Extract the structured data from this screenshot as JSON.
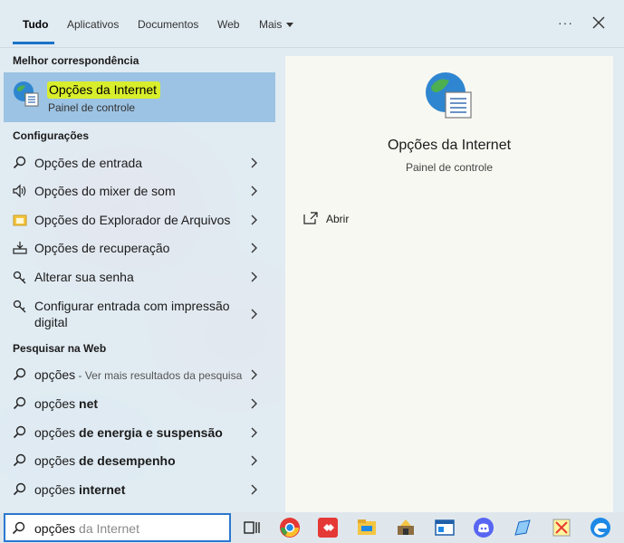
{
  "tabs": [
    "Tudo",
    "Aplicativos",
    "Documentos",
    "Web",
    "Mais"
  ],
  "toolbar": {
    "more_options": "···"
  },
  "sections": {
    "best_match": "Melhor correspondência",
    "settings": "Configurações",
    "web": "Pesquisar na Web"
  },
  "best_match": {
    "title": "Opções da Internet",
    "subtitle": "Painel de controle",
    "highlight_color": "#d8ee2c"
  },
  "settings_items": [
    {
      "label": "Opções de entrada",
      "icon": "search-icon"
    },
    {
      "label": "Opções do mixer de som",
      "icon": "speaker-icon"
    },
    {
      "label": "Opções do Explorador de Arquivos",
      "icon": "folder-icon"
    },
    {
      "label": "Opções de recuperação",
      "icon": "recovery-icon"
    },
    {
      "label": "Alterar sua senha",
      "icon": "key-icon"
    },
    {
      "label": "Configurar entrada com impressão digital",
      "icon": "key-icon"
    }
  ],
  "web_items": [
    {
      "prefix": "opções",
      "suffix": "",
      "hint": " - Ver mais resultados da pesquisa"
    },
    {
      "prefix": "opções ",
      "suffix": "net",
      "hint": ""
    },
    {
      "prefix": "opções ",
      "suffix": "de energia e suspensão",
      "hint": ""
    },
    {
      "prefix": "opções ",
      "suffix": "de desempenho",
      "hint": ""
    },
    {
      "prefix": "opções ",
      "suffix": "internet",
      "hint": ""
    }
  ],
  "preview": {
    "title": "Opções da Internet",
    "subtitle": "Painel de controle",
    "open_label": "Abrir"
  },
  "search": {
    "value": "opções",
    "autocomplete": " da Internet"
  },
  "taskbar_icons": [
    "task-view-icon",
    "chrome-icon",
    "anydesk-icon",
    "file-explorer-icon",
    "app-icon",
    "window-icon",
    "discord-icon",
    "tool-icon",
    "snipping-icon",
    "edge-icon"
  ],
  "colors": {
    "accent": "#1a73c8",
    "selected": "#9cc3e3"
  }
}
